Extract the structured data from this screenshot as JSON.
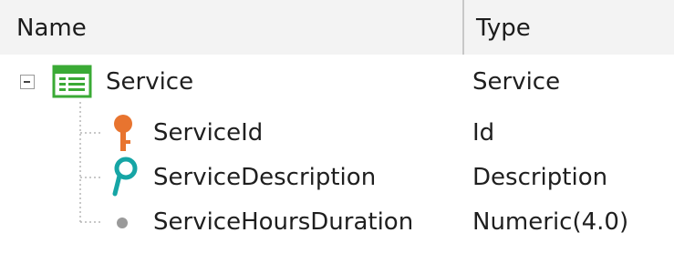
{
  "header": {
    "name_label": "Name",
    "type_label": "Type"
  },
  "tree": {
    "root": {
      "name": "Service",
      "type": "Service",
      "icon": "transaction-table-icon",
      "expanded": true
    },
    "children": [
      {
        "name": "ServiceId",
        "type": "Id",
        "icon": "primary-key-icon"
      },
      {
        "name": "ServiceDescription",
        "type": "Description",
        "icon": "description-attribute-icon"
      },
      {
        "name": "ServiceHoursDuration",
        "type": "Numeric(4.0)",
        "icon": "attribute-dot-icon"
      }
    ]
  },
  "colors": {
    "header_bg": "#f3f3f3",
    "key_orange": "#e8742f",
    "description_teal": "#16a5a5",
    "table_green": "#3aaa35",
    "dot_gray": "#9a9a9a"
  }
}
